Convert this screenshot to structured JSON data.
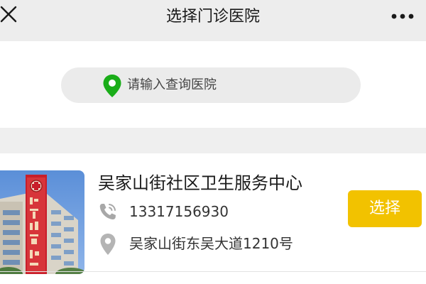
{
  "header": {
    "title": "选择门诊医院",
    "close_icon": "close-icon",
    "more_icon": "more-dots-icon"
  },
  "search": {
    "placeholder": "请输入查询医院",
    "icon": "location-pin-icon"
  },
  "hospitals": [
    {
      "name": "吴家山街社区卫生服务中心",
      "phone": "13317156930",
      "address": "吴家山街东吴大道1210号",
      "select_label": "选择"
    }
  ],
  "colors": {
    "header_bg": "#ededed",
    "accent_yellow": "#f2c200",
    "pin_green": "#1aad19",
    "icon_gray": "#a8a8a8"
  }
}
